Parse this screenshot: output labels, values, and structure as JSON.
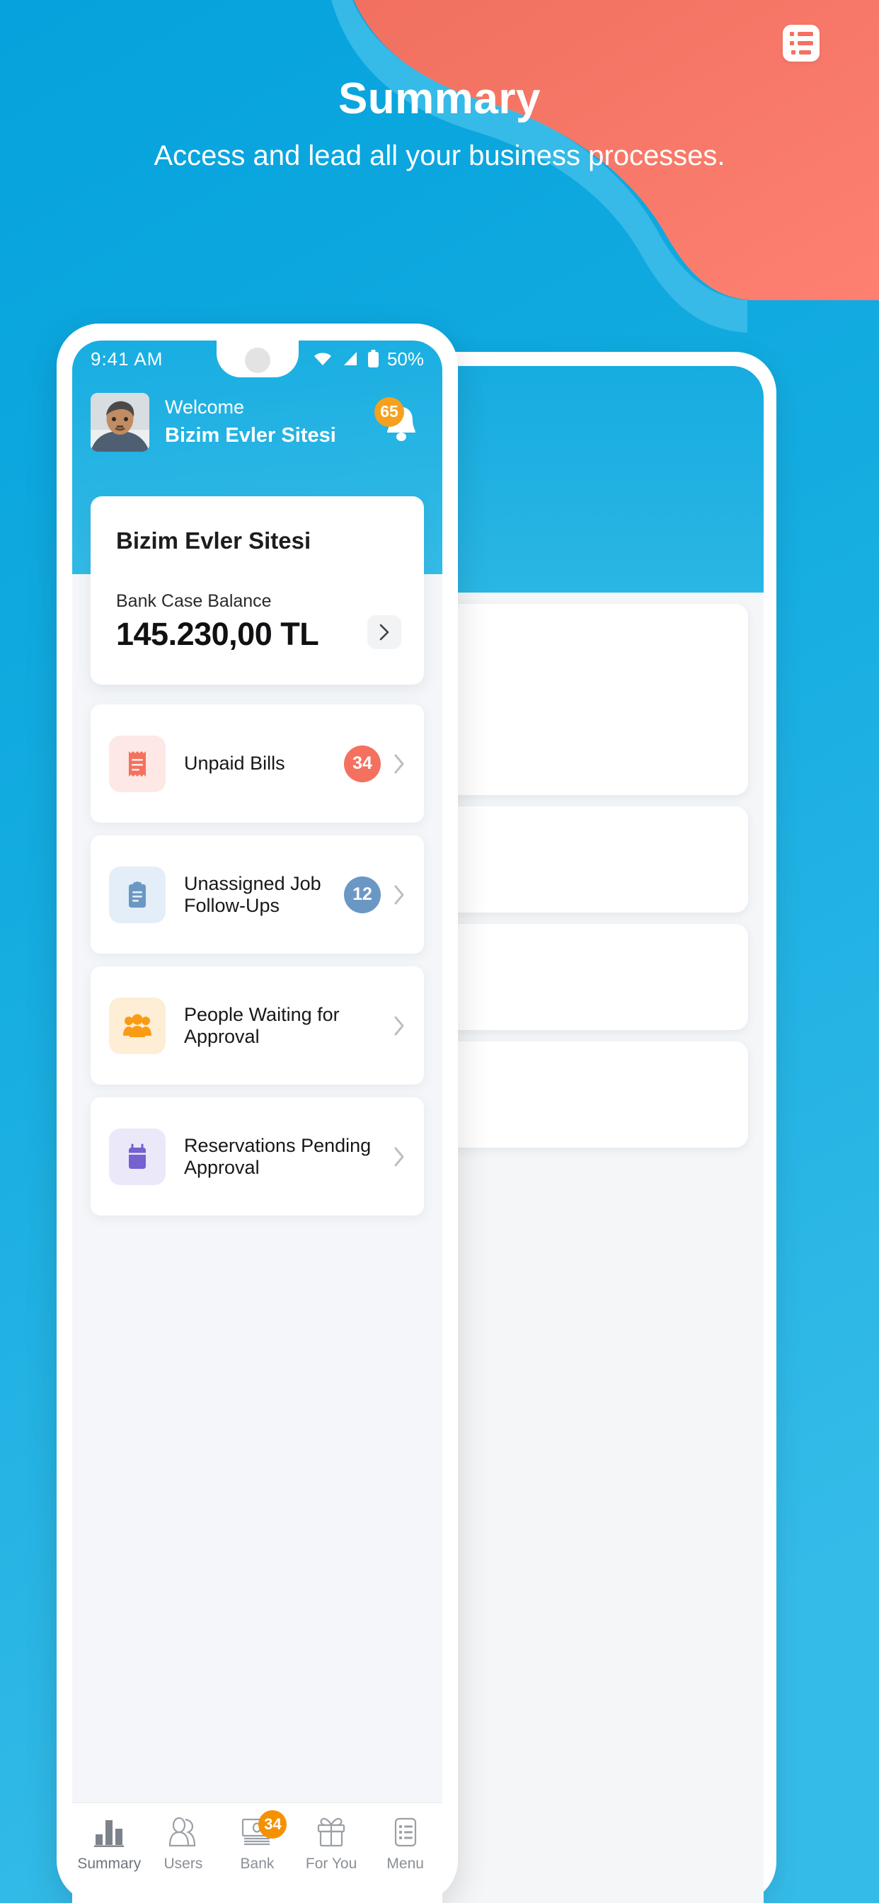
{
  "hero": {
    "title": "Summary",
    "subtitle": "Access and lead all your business processes.",
    "menu_icon": "list-menu-icon"
  },
  "colors": {
    "bg_blue": "#0aa3dd",
    "bg_blue_light": "#35b8e8",
    "coral": "#fa7465",
    "accent_orange": "#f59100",
    "badge_red": "#f4715f",
    "badge_blue": "#6b97c4"
  },
  "phone": {
    "statusbar": {
      "time": "9:41  AM",
      "battery_percent": "50%",
      "wifi_icon": "wifi-icon",
      "signal_icon": "cellular-signal-icon",
      "battery_icon": "battery-icon"
    },
    "welcome": {
      "greeting": "Welcome",
      "name": "Bizim Evler Sitesi",
      "avatar": "user-avatar",
      "bell_icon": "notification-bell-icon",
      "bell_badge": "65"
    },
    "balance_card": {
      "title": "Bizim Evler Sitesi",
      "label": "Bank Case Balance",
      "amount": "145.230,00 TL",
      "arrow_icon": "chevron-right-icon"
    },
    "list": [
      {
        "label": "Unpaid Bills",
        "icon": "receipt-icon",
        "badge": "34",
        "badge_color": "#f4715f",
        "icon_color": "#f4715f",
        "icon_bg": "#fde8e5"
      },
      {
        "label": "Unassigned Job Follow-Ups",
        "icon": "clipboard-icon",
        "badge": "12",
        "badge_color": "#6b97c4",
        "icon_color": "#6b97c4",
        "icon_bg": "#e3eef8"
      },
      {
        "label": "People Waiting for Approval",
        "icon": "people-icon",
        "badge": "",
        "badge_color": "",
        "icon_color": "#fa9b15",
        "icon_bg": "#fdeed5"
      },
      {
        "label": "Reservations Pending Approval",
        "icon": "calendar-icon",
        "badge": "",
        "badge_color": "",
        "icon_color": "#7561d0",
        "icon_bg": "#ebe8fa"
      }
    ],
    "bottom_nav": [
      {
        "label": "Summary",
        "icon": "bar-chart-icon",
        "active": true,
        "badge": ""
      },
      {
        "label": "Users",
        "icon": "people-outline-icon",
        "active": false,
        "badge": ""
      },
      {
        "label": "Bank",
        "icon": "money-icon",
        "active": false,
        "badge": "34"
      },
      {
        "label": "For You",
        "icon": "gift-icon",
        "active": false,
        "badge": ""
      },
      {
        "label": "Menu",
        "icon": "list-icon",
        "active": false,
        "badge": ""
      }
    ]
  }
}
